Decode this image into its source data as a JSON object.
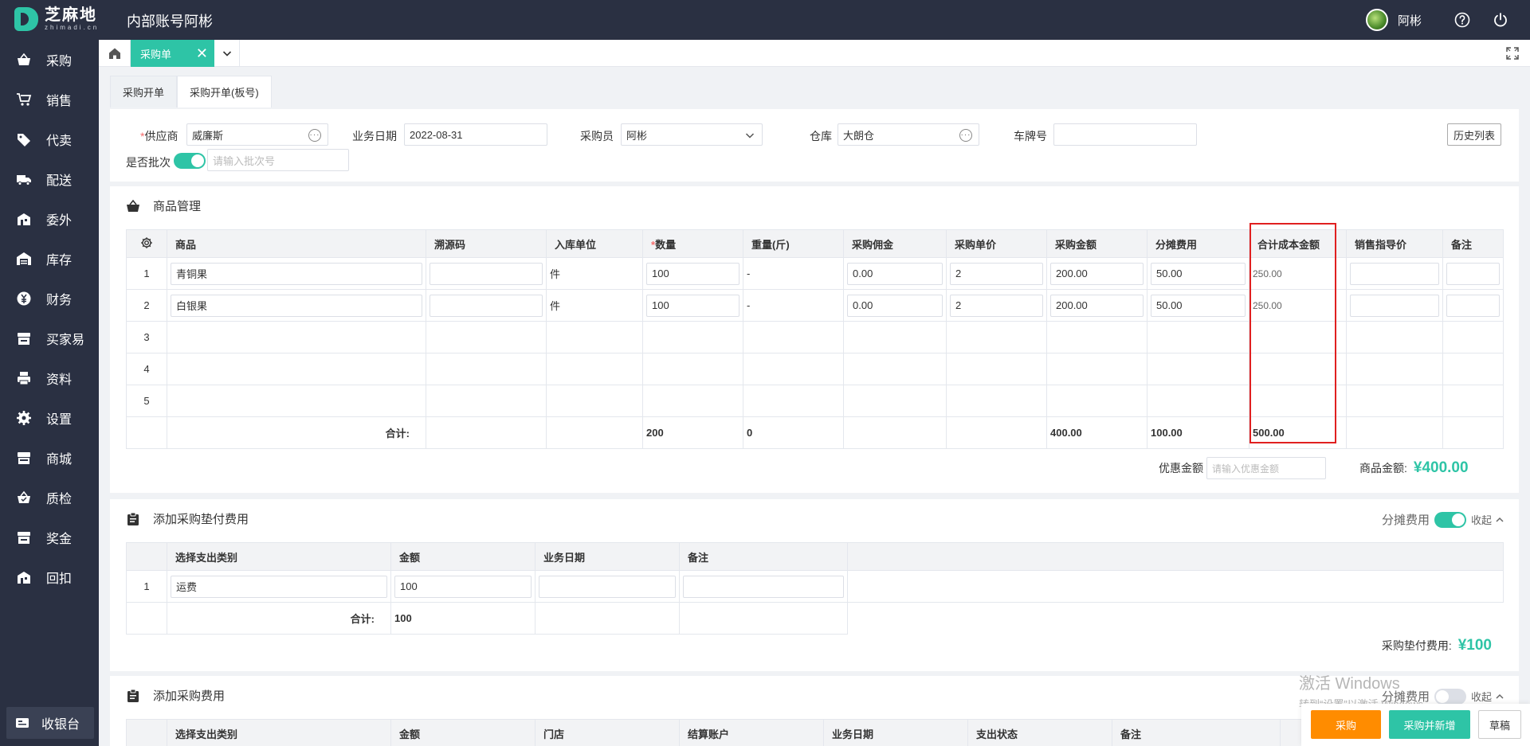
{
  "app": {
    "logo_cn": "芝麻地",
    "logo_en": "zhimadi.cn",
    "title": "内部账号阿彬",
    "user_name": "阿彬"
  },
  "sidebar": {
    "items": [
      {
        "label": "采购",
        "icon": "basket-icon"
      },
      {
        "label": "销售",
        "icon": "cart-icon"
      },
      {
        "label": "代卖",
        "icon": "tag-icon"
      },
      {
        "label": "配送",
        "icon": "truck-icon"
      },
      {
        "label": "委外",
        "icon": "building-icon"
      },
      {
        "label": "库存",
        "icon": "warehouse-icon"
      },
      {
        "label": "财务",
        "icon": "yen-icon"
      },
      {
        "label": "买家易",
        "icon": "store-icon"
      },
      {
        "label": "资料",
        "icon": "printer-icon"
      },
      {
        "label": "设置",
        "icon": "gear-icon"
      },
      {
        "label": "商城",
        "icon": "shop-icon"
      },
      {
        "label": "质检",
        "icon": "basket-check-icon"
      },
      {
        "label": "奖金",
        "icon": "bonus-icon"
      },
      {
        "label": "回扣",
        "icon": "rebate-icon"
      }
    ],
    "cashier": "收银台"
  },
  "tabs": {
    "active": "采购单",
    "close": "✕"
  },
  "subtabs": [
    "采购开单",
    "采购开单(板号)"
  ],
  "form": {
    "supplier_label": "供应商",
    "supplier_value": "威廉斯",
    "date_label": "业务日期",
    "date_value": "2022-08-31",
    "buyer_label": "采购员",
    "buyer_value": "阿彬",
    "warehouse_label": "仓库",
    "warehouse_value": "大朗仓",
    "plate_label": "车牌号",
    "plate_value": "",
    "history_btn": "历史列表",
    "batch_label": "是否批次",
    "batch_placeholder": "请输入批次号",
    "required_mark": "*"
  },
  "goods": {
    "title": "商品管理",
    "columns": [
      "商品",
      "溯源码",
      "入库单位",
      "数量",
      "重量(斤)",
      "采购佣金",
      "采购单价",
      "采购金额",
      "分摊费用",
      "合计成本金额",
      "销售指导价",
      "备注"
    ],
    "rows": [
      {
        "idx": "1",
        "name": "青铜果",
        "trace": "",
        "unit": "件",
        "qty": "100",
        "weight": "-",
        "commission": "0.00",
        "price": "2",
        "amount": "200.00",
        "share": "50.00",
        "cost": "250.00"
      },
      {
        "idx": "2",
        "name": "白银果",
        "trace": "",
        "unit": "件",
        "qty": "100",
        "weight": "-",
        "commission": "0.00",
        "price": "2",
        "amount": "200.00",
        "share": "50.00",
        "cost": "250.00"
      },
      {
        "idx": "3"
      },
      {
        "idx": "4"
      },
      {
        "idx": "5"
      }
    ],
    "sum_label": "合计:",
    "sum": {
      "qty": "200",
      "weight": "0",
      "amount": "400.00",
      "share": "100.00",
      "cost": "500.00"
    },
    "discount_label": "优惠金额",
    "discount_placeholder": "请输入优惠金额",
    "total_label": "商品金额:",
    "total_value": "¥400.00"
  },
  "advance": {
    "title": "添加采购垫付费用",
    "share_label": "分摊费用",
    "collapse_label": "收起",
    "columns": [
      "选择支出类别",
      "金额",
      "业务日期",
      "备注"
    ],
    "rows": [
      {
        "idx": "1",
        "category": "运费",
        "amount": "100",
        "date": "",
        "note": ""
      }
    ],
    "sum_label": "合计:",
    "sum_amount": "100",
    "total_label": "采购垫付费用:",
    "total_value": "¥100"
  },
  "expense": {
    "title": "添加采购费用",
    "share_label": "分摊费用",
    "collapse_label": "收起",
    "columns": [
      "选择支出类别",
      "金额",
      "门店",
      "结算账户",
      "业务日期",
      "支出状态",
      "备注"
    ]
  },
  "actions": {
    "purchase": "采购",
    "purchase_new": "采购并新增",
    "draft": "草稿"
  },
  "watermark": {
    "line1": "激活 Windows",
    "line2": "转到“设置”以激活 Windows。"
  },
  "colors": {
    "accent": "#2ec4a6",
    "sidebar": "#2a3042",
    "orange": "#ff8c00",
    "highlight": "#e02020"
  }
}
